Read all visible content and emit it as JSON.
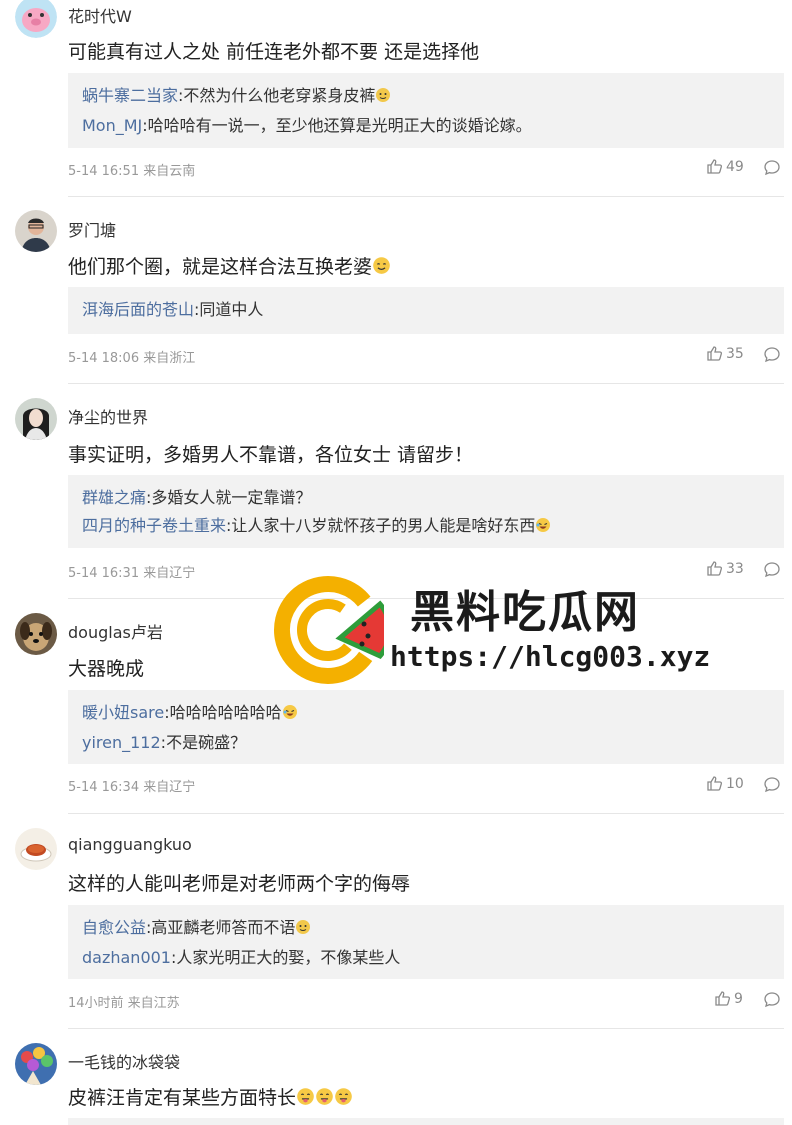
{
  "comments": [
    {
      "username": "花时代W",
      "text": "可能真有过人之处 前任连老外都不要 还是选择他",
      "replies": [
        {
          "name": "蜗牛寨二当家",
          "text": ":不然为什么他老穿紧身皮裤"
        },
        {
          "name": "Mon_MJ",
          "text": ":哈哈哈有一说一，至少他还算是光明正大的谈婚论嫁。"
        }
      ],
      "meta": "5-14 16:51 来自云南",
      "likes": "49"
    },
    {
      "username": "罗门塘",
      "text": "他们那个圈，就是这样合法互换老婆",
      "replies": [
        {
          "name": "洱海后面的苍山",
          "text": ":同道中人"
        }
      ],
      "meta": "5-14 18:06 来自浙江",
      "likes": "35"
    },
    {
      "username": "净尘的世界",
      "text": "事实证明，多婚男人不靠谱，各位女士 请留步！",
      "replies": [
        {
          "name": "群雄之痛",
          "text": ":多婚女人就一定靠谱？"
        },
        {
          "name": "四月的种子卷土重来",
          "text": ":让人家十八岁就怀孩子的男人能是啥好东西"
        }
      ],
      "meta": "5-14 16:31 来自辽宁",
      "likes": "33"
    },
    {
      "username": "douglas卢岩",
      "text": "大器晚成",
      "replies": [
        {
          "name": "暖小妞sare",
          "text": ":哈哈哈哈哈哈哈"
        },
        {
          "name": "yiren_112",
          "text": ":不是碗盛？"
        }
      ],
      "meta": "5-14 16:34 来自辽宁",
      "likes": "10"
    },
    {
      "username": "qiangguangkuo",
      "text": "这样的人能叫老师是对老师两个字的侮辱",
      "replies": [
        {
          "name": "自愈公益",
          "text": ":高亚麟老师答而不语"
        },
        {
          "name": "dazhan001",
          "text": ":人家光明正大的娶，不像某些人"
        }
      ],
      "meta": "14小时前 来自江苏",
      "likes": "9"
    },
    {
      "username": "一毛钱的冰袋袋",
      "text": "皮裤汪肯定有某些方面特长",
      "replies": [],
      "meta": "",
      "likes": ""
    }
  ],
  "watermark": {
    "title": "黑料吃瓜网",
    "url": "https://hlcg003.xyz",
    "colors": {
      "ring": "#f4b000",
      "melon_red": "#e53935",
      "melon_green": "#2e9d3a"
    }
  },
  "icons": {
    "like": "thumbs-up-icon",
    "comment": "comment-bubble-icon"
  },
  "colors": {
    "reply_name": "#4d6e9f",
    "meta": "#999999",
    "reply_bg": "#f2f2f2"
  }
}
